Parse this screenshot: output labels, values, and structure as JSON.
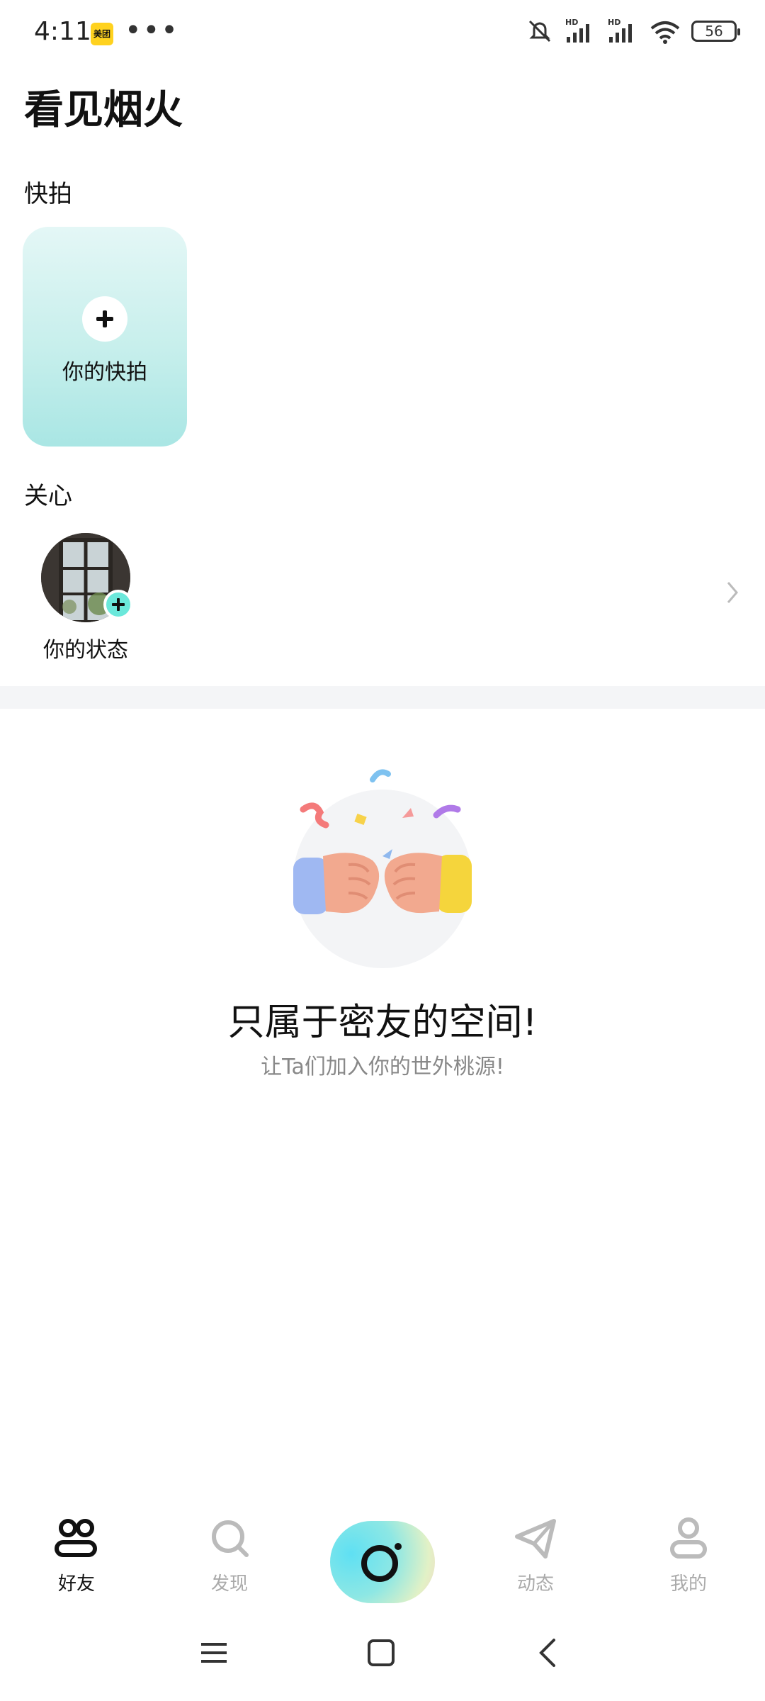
{
  "status_bar": {
    "time": "4:11",
    "app_badge": "美团",
    "more": "•••",
    "battery": "56"
  },
  "page_title": "看见烟火",
  "snap": {
    "section_label": "快拍",
    "card_label": "你的快拍"
  },
  "care": {
    "section_label": "关心",
    "status_label": "你的状态"
  },
  "empty_state": {
    "title": "只属于密友的空间!",
    "subtitle": "让Ta们加入你的世外桃源!"
  },
  "bottom_nav": {
    "friends": "好友",
    "discover": "发现",
    "moments": "动态",
    "me": "我的"
  },
  "colors": {
    "accent": "#6be8db",
    "inactive": "#aaaaaa",
    "active": "#111111"
  }
}
